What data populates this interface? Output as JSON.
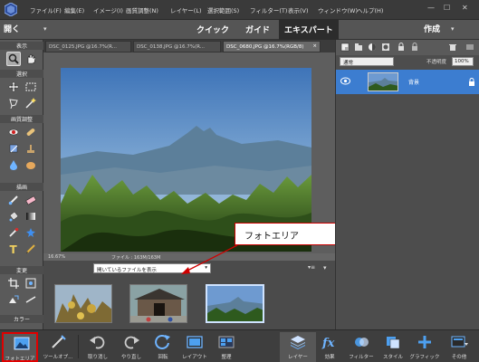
{
  "menubar": {
    "items": [
      "ファイル(F)",
      "編集(E)",
      "イメージ(I)",
      "画質調整(N)",
      "レイヤー(L)",
      "選択範囲(S)",
      "フィルター(T)",
      "表示(V)",
      "ウィンドウ(W)",
      "ヘルプ(H)"
    ],
    "minimize": "—",
    "maximize": "☐",
    "close": "✕"
  },
  "modebar": {
    "open_label": "開く",
    "open_dropdown": "▾",
    "tabs": [
      "クイック",
      "ガイド",
      "エキスパート"
    ],
    "active_tab": "エキスパート",
    "create_label": "作成",
    "create_dropdown": "▾"
  },
  "toolbox": {
    "sections": [
      "表示",
      "選択",
      "画質調整",
      "描画",
      "変更",
      "カラー"
    ]
  },
  "documents": {
    "tabs": [
      "DSC_0125.JPG @16.7%(R...",
      "DSC_0138.JPG @16.7%(R...",
      "DSC_0680.JPG @16.7%(RGB/8)"
    ],
    "active_index": 2,
    "close_glyph": "×"
  },
  "status": {
    "zoom": "16.67%",
    "filesize": "ファイル : 163M/163M"
  },
  "photobin": {
    "select_value": "開いているファイルを表示",
    "select_dd": "▾",
    "menu_glyph": "▾≡",
    "collapse_glyph": "▾"
  },
  "callout": {
    "text": "フォトエリア"
  },
  "layers": {
    "blend_mode": "通常",
    "opacity_label": "不透明度",
    "opacity_value": "100%",
    "layer_name": "背景"
  },
  "taskbar": {
    "photo_area": "フォトエリア",
    "tool_options": "ツールオプ...",
    "undo": "取り消し",
    "redo": "やり直し",
    "rotate": "回転",
    "layout": "レイアウト",
    "organizer": "整理",
    "layers": "レイヤー",
    "effects": "効果",
    "filters": "フィルター",
    "styles": "スタイル",
    "graphics": "グラフィック",
    "more": "その他"
  },
  "colors": {
    "accent": "#3c7dd0",
    "highlight": "#e00000"
  }
}
